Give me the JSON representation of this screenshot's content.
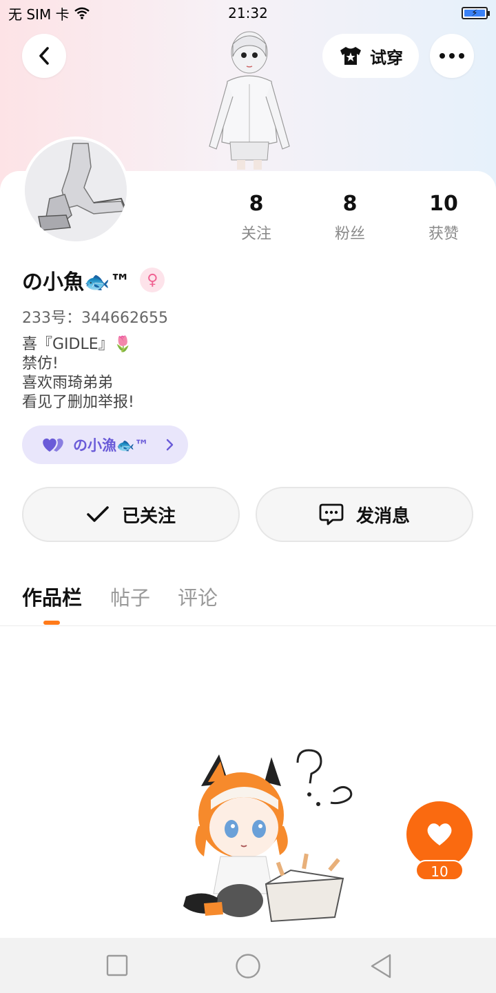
{
  "status_bar": {
    "carrier": "无 SIM 卡",
    "time": "21:32",
    "wifi_icon": "wifi-icon",
    "battery_icon": "battery-charging-icon"
  },
  "header": {
    "back_icon": "back-arrow-icon",
    "tryon_label": "试穿",
    "tryon_icon": "tshirt-star-icon",
    "more_icon": "more-dots-icon"
  },
  "profile": {
    "name": "の小魚🐟™",
    "gender_icon": "female-icon",
    "uid": "233号：344662655",
    "bio_lines": [
      "喜『GIDLE』🌷",
      "禁仿!",
      "喜欢雨琦弟弟",
      "看见了删加举报!"
    ],
    "fan_group": {
      "label": "の小漁🐟™",
      "icon": "double-heart-icon"
    }
  },
  "stats": [
    {
      "value": "8",
      "label": "关注"
    },
    {
      "value": "8",
      "label": "粉丝"
    },
    {
      "value": "10",
      "label": "获赞"
    }
  ],
  "actions": {
    "follow_label": "已关注",
    "message_label": "发消息"
  },
  "tabs": [
    {
      "label": "作品栏",
      "active": true
    },
    {
      "label": "帖子",
      "active": false
    },
    {
      "label": "评论",
      "active": false
    }
  ],
  "like_fab": {
    "count": "10",
    "icon": "heart-icon"
  },
  "colors": {
    "accent_orange": "#fa6a10",
    "fan_pill_bg": "#e9e6fb",
    "fan_pill_text": "#6a5bd8"
  }
}
